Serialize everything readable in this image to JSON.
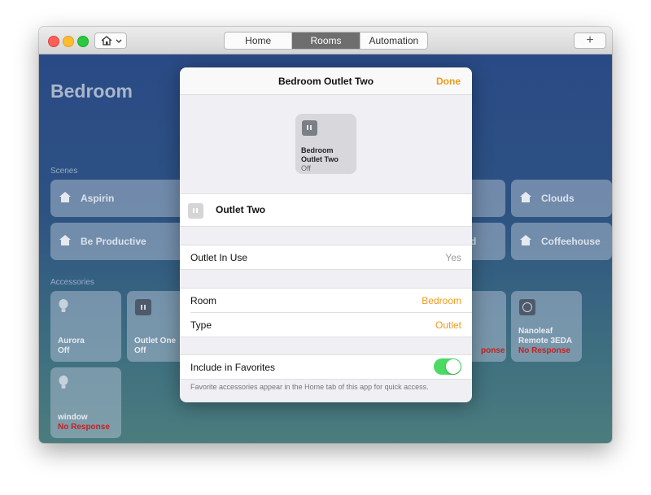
{
  "window": {
    "tabs": [
      {
        "label": "Home",
        "active": false
      },
      {
        "label": "Rooms",
        "active": true
      },
      {
        "label": "Automation",
        "active": false
      }
    ],
    "add_label": "+"
  },
  "room": {
    "title": "Bedroom",
    "scenes_label": "Scenes",
    "accessories_label": "Accessories",
    "scenes": [
      "Aspirin",
      "Clouds",
      "Be Productive",
      "d",
      "Coffeehouse"
    ],
    "accessories": [
      {
        "name": "Aurora",
        "status": "Off",
        "icon": "lightbulb-icon"
      },
      {
        "name": "Outlet One",
        "status": "Off",
        "icon": "outlet-icon"
      },
      {
        "name": "",
        "status": "ponse",
        "icon": ""
      },
      {
        "name": "Nanoleaf Remote 3EDA",
        "status": "No Response",
        "icon": "nanoleaf-remote-icon"
      },
      {
        "name": "window",
        "status": "No Response",
        "icon": "lightbulb-icon"
      }
    ]
  },
  "modal": {
    "title": "Bedroom Outlet Two",
    "done_label": "Done",
    "tile_name": "Bedroom Outlet Two",
    "tile_status": "Off",
    "name_value": "Outlet Two",
    "outlet_in_use_label": "Outlet In Use",
    "outlet_in_use_value": "Yes",
    "room_label": "Room",
    "room_value": "Bedroom",
    "type_label": "Type",
    "type_value": "Outlet",
    "favorites_label": "Include in Favorites",
    "favorites_on": true,
    "favorites_note": "Favorite accessories appear in the Home tab of this app for quick access."
  },
  "colors": {
    "accent": "#f09a1b",
    "toggle_on": "#4cd964",
    "no_response": "#c62020",
    "background_top": "#2a4a86",
    "background_bottom": "#4b7d7e"
  }
}
